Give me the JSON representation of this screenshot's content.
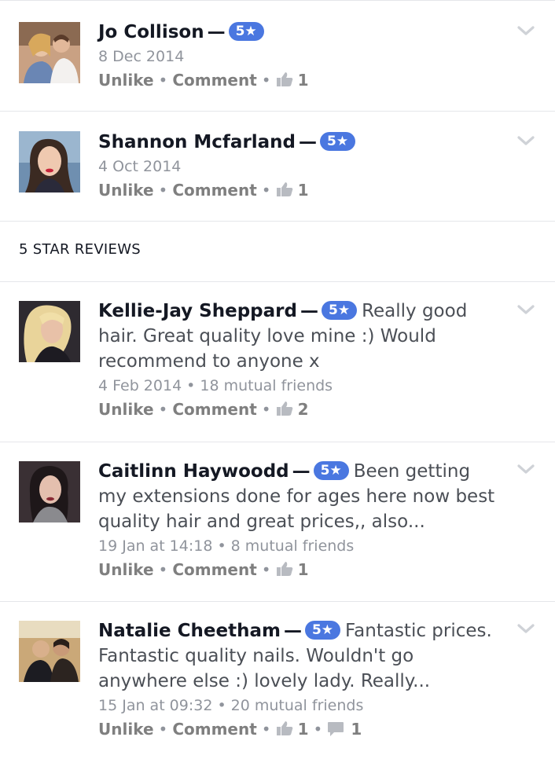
{
  "top_reviews": [
    {
      "name": "Jo Collison",
      "rating": "5★",
      "date": "8 Dec 2014",
      "unlike": "Unlike",
      "comment": "Comment",
      "likes": "1"
    },
    {
      "name": "Shannon Mcfarland",
      "rating": "5★",
      "date": "4 Oct 2014",
      "unlike": "Unlike",
      "comment": "Comment",
      "likes": "1"
    }
  ],
  "section_title": "5 STAR REVIEWS",
  "reviews": [
    {
      "name": "Kellie-Jay Sheppard",
      "rating": "5★",
      "text": "Really good hair. Great quality love mine :) Would recommend to anyone x",
      "date": "4 Feb 2014",
      "mutual": "18 mutual friends",
      "unlike": "Unlike",
      "comment": "Comment",
      "likes": "2"
    },
    {
      "name": "Caitlinn Haywoodd",
      "rating": "5★",
      "text": "Been getting my extensions done for ages here now best quality hair and great prices,, also...",
      "date": "19 Jan at 14:18",
      "mutual": "8 mutual friends",
      "unlike": "Unlike",
      "comment": "Comment",
      "likes": "1"
    },
    {
      "name": "Natalie Cheetham",
      "rating": "5★",
      "text": "Fantastic prices. Fantastic quality nails. Wouldn't go anywhere else :) lovely lady. Really...",
      "date": "15 Jan at 09:32",
      "mutual": "20 mutual friends",
      "unlike": "Unlike",
      "comment": "Comment",
      "likes": "1",
      "comments": "1"
    }
  ],
  "icons": {
    "like": "thumbs-up-icon",
    "comment": "comment-bubble-icon",
    "menu": "chevron-down-icon"
  },
  "colors": {
    "badge": "#4a77e0",
    "text": "#141823",
    "muted": "#90949c",
    "divider": "#e5e6ea"
  }
}
